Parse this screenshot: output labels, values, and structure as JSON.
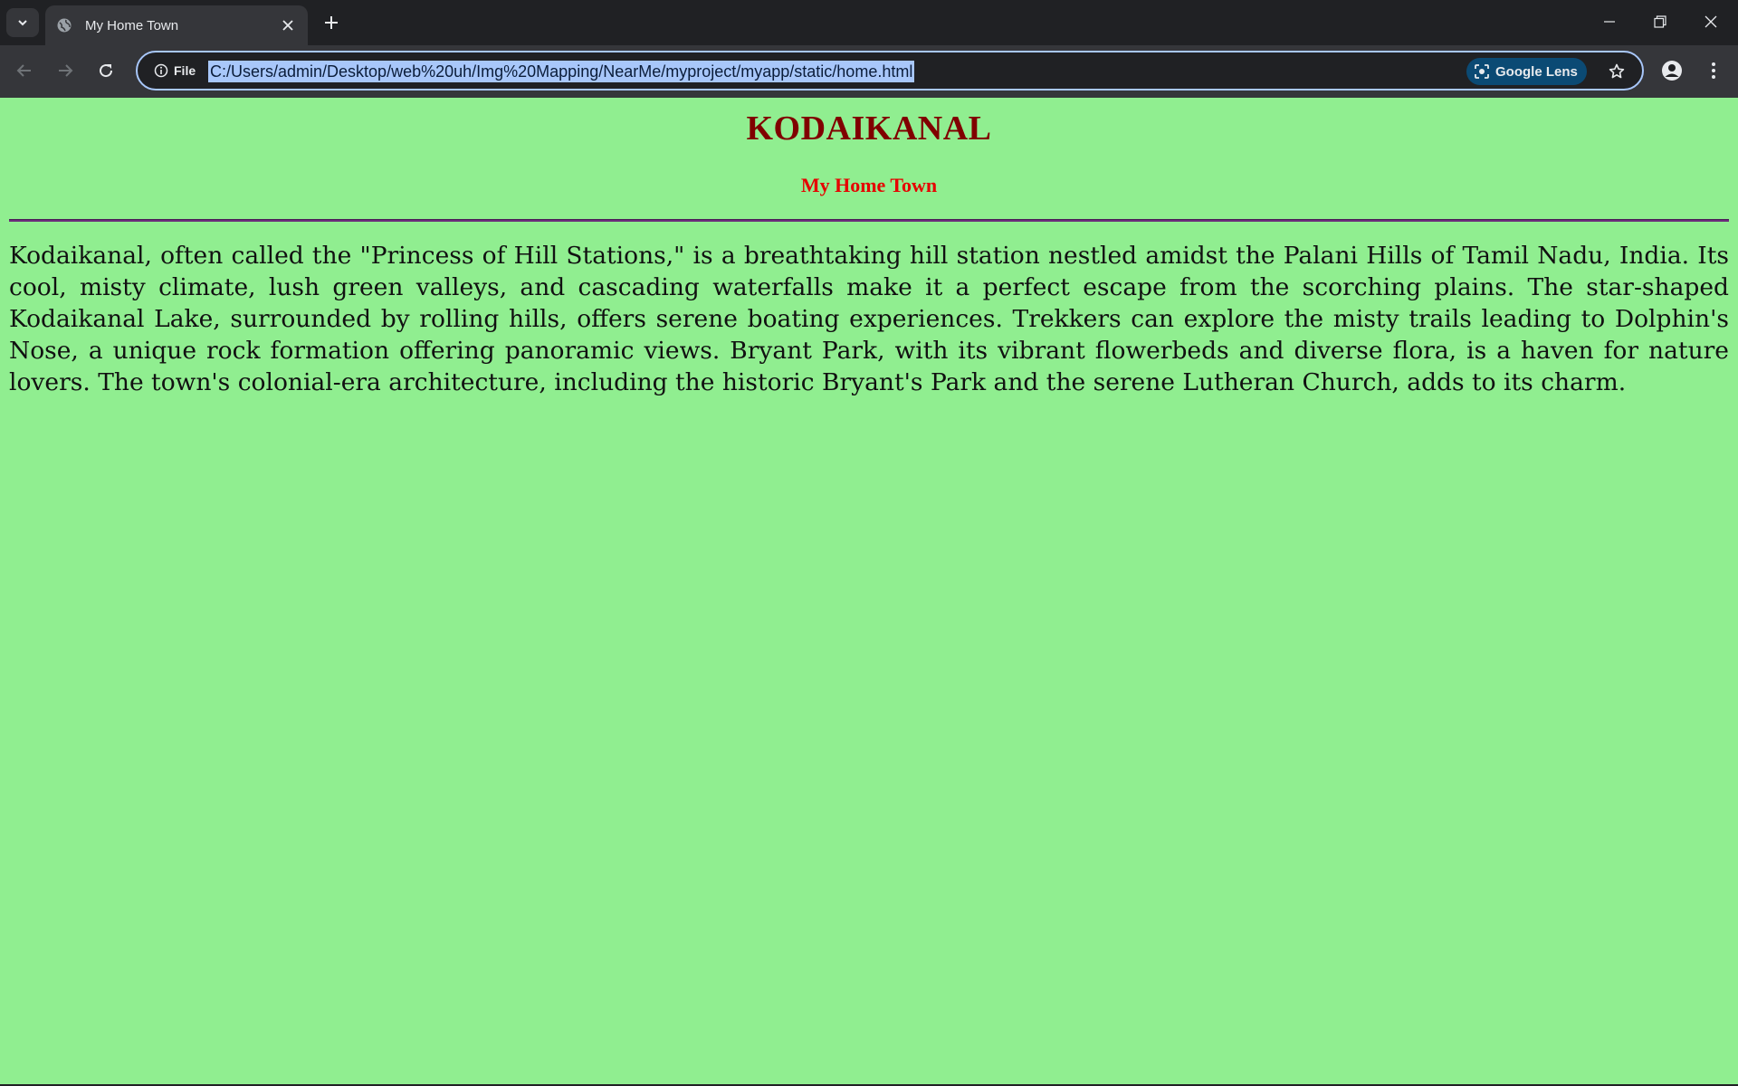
{
  "browser": {
    "tab": {
      "title": "My Home Town"
    },
    "address": {
      "scheme_label": "File",
      "url": "C:/Users/admin/Desktop/web%20uh/Img%20Mapping/NearMe/myproject/myapp/static/home.html"
    },
    "lens_label": "Google Lens",
    "accent_color": "#a8c7fa"
  },
  "page": {
    "background": "#90ee90",
    "title": "KODAIKANAL",
    "subtitle": "My Home Town",
    "paragraph": "Kodaikanal, often called the \"Princess of Hill Stations,\" is a breathtaking hill station nestled amidst the Palani Hills of Tamil Nadu, India. Its cool, misty climate, lush green valleys, and cascading waterfalls make it a perfect escape from the scorching plains. The star-shaped Kodaikanal Lake, surrounded by rolling hills, offers serene boating experiences. Trekkers can explore the misty trails leading to Dolphin's Nose, a unique rock formation offering panoramic views. Bryant Park, with its vibrant flowerbeds and diverse flora, is a haven for nature lovers. The town's colonial-era architecture, including the historic Bryant's Park and the serene Lutheran Church, adds to its charm."
  },
  "icons": [
    "chevron-down-icon",
    "globe-icon",
    "close-icon",
    "plus-icon",
    "minimize-icon",
    "restore-icon",
    "back-icon",
    "forward-icon",
    "reload-icon",
    "info-icon",
    "lens-icon",
    "star-icon",
    "profile-icon",
    "more-icon"
  ]
}
